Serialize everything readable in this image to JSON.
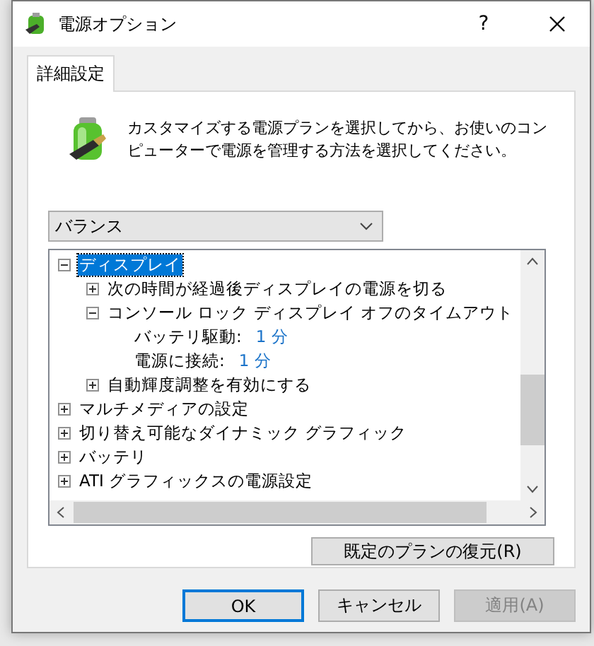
{
  "window": {
    "title": "電源オプション",
    "help": "?"
  },
  "tabs": [
    {
      "label": "詳細設定",
      "selected": true
    }
  ],
  "description": "カスタマイズする電源プランを選択してから、お使いのコンピューターで電源を管理する方法を選択してください。",
  "plan": {
    "value": "バランス"
  },
  "tree": [
    {
      "kind": "group",
      "label": "ディスプレイ",
      "expanded": true,
      "selected": true,
      "children": [
        {
          "kind": "group",
          "label": "次の時間が経過後ディスプレイの電源を切る",
          "expanded": false,
          "selected": false
        },
        {
          "kind": "group",
          "label": "コンソール ロック ディスプレイ オフのタイムアウト",
          "expanded": true,
          "selected": false,
          "children": [
            {
              "kind": "setting",
              "label": "バッテリ駆動:",
              "value": "1 分"
            },
            {
              "kind": "setting",
              "label": "電源に接続:",
              "value": "1 分"
            }
          ]
        },
        {
          "kind": "group",
          "label": "自動輝度調整を有効にする",
          "expanded": false,
          "selected": false
        }
      ]
    },
    {
      "kind": "group",
      "label": "マルチメディアの設定",
      "expanded": false,
      "selected": false
    },
    {
      "kind": "group",
      "label": "切り替え可能なダイナミック グラフィック",
      "expanded": false,
      "selected": false
    },
    {
      "kind": "group",
      "label": "バッテリ",
      "expanded": false,
      "selected": false
    },
    {
      "kind": "group",
      "label": "ATI グラフィックスの電源設定",
      "expanded": false,
      "selected": false
    }
  ],
  "restore_button": "既定のプランの復元(R)",
  "buttons": [
    {
      "label": "OK",
      "default": true,
      "disabled": false
    },
    {
      "label": "キャンセル",
      "default": false,
      "disabled": false
    },
    {
      "label": "適用(A)",
      "default": false,
      "disabled": true
    }
  ]
}
